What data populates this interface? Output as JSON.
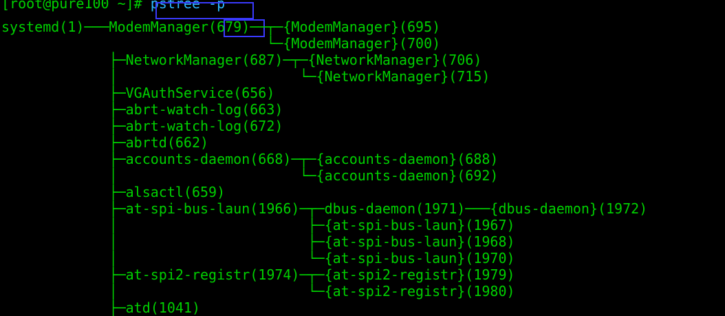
{
  "terminal": {
    "prompt": "[root@pure100 ~]# ",
    "command": "pstree -p",
    "colors": {
      "background": "#000000",
      "text": "#00d000",
      "command_text": "#2db8ff",
      "highlight_box": "#3a3aff"
    },
    "lines": [
      "systemd(1)───ModemManager(679)──┬─{ModemManager}(695)",
      "                                └─{ModemManager}(700)",
      "             ├─NetworkManager(687)─┬─{NetworkManager}(706)",
      "             │                      └─{NetworkManager}(715)",
      "             ├─VGAuthService(656)",
      "             ├─abrt-watch-log(663)",
      "             ├─abrt-watch-log(672)",
      "             ├─abrtd(662)",
      "             ├─accounts-daemon(668)─┬─{accounts-daemon}(688)",
      "             │                      └─{accounts-daemon}(692)",
      "             ├─alsactl(659)",
      "             ├─at-spi-bus-laun(1966)─┬─dbus-daemon(1971)───{dbus-daemon}(1972)",
      "             │                       ├─{at-spi-bus-laun}(1967)",
      "             │                       ├─{at-spi-bus-laun}(1968)",
      "             │                       └─{at-spi-bus-laun}(1970)",
      "             ├─at-spi2-registr(1974)─┬─{at-spi2-registr}(1979)",
      "             │                       └─{at-spi2-registr}(1980)",
      "             ├─atd(1041)"
    ]
  }
}
